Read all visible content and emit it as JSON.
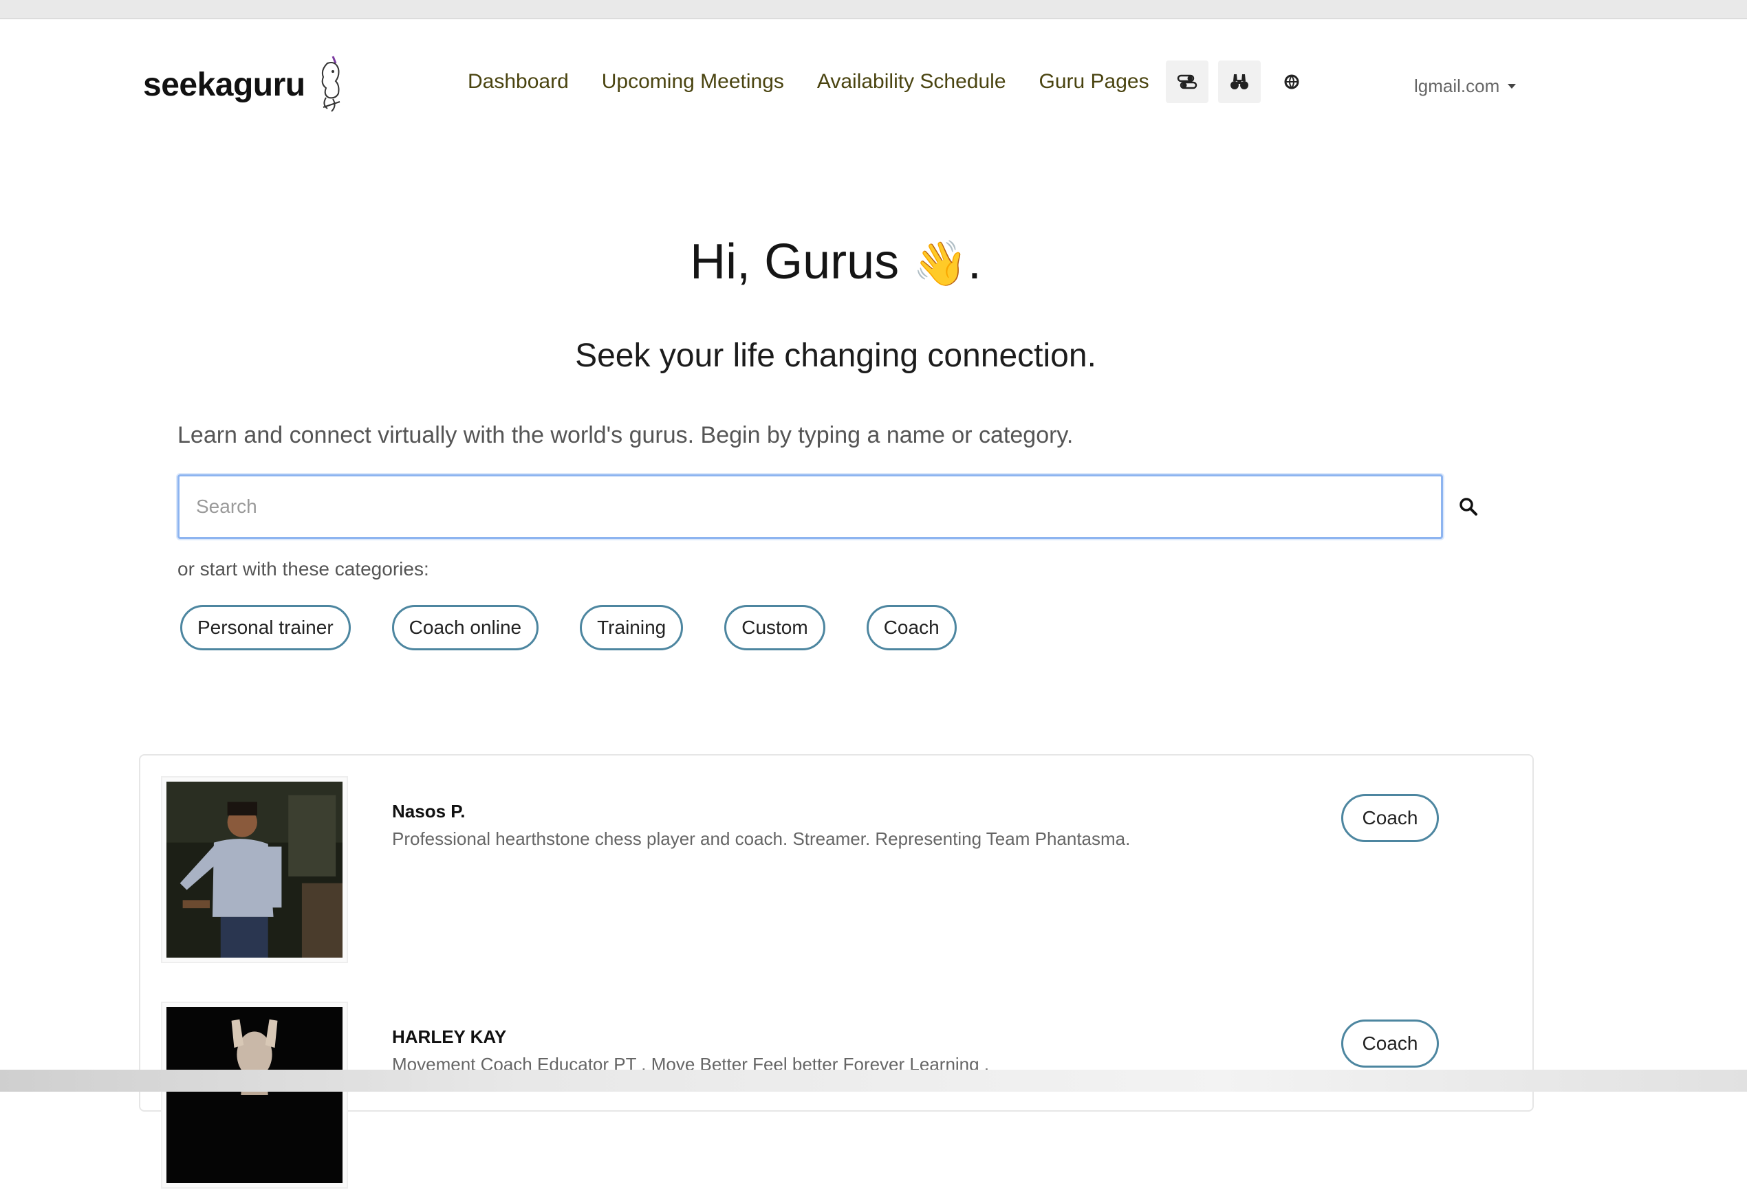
{
  "brand": {
    "name": "seekaguru"
  },
  "nav": {
    "links": [
      "Dashboard",
      "Upcoming Meetings",
      "Availability Schedule",
      "Guru Pages"
    ],
    "icons": [
      "toggle-settings-icon",
      "binoculars-icon",
      "globe-icon"
    ],
    "account": "lgmail.com"
  },
  "hero": {
    "greeting": "Hi, Gurus",
    "emoji": "👋",
    "period": ".",
    "subtitle": "Seek your life changing connection.",
    "intro": "Learn and connect virtually with the world's gurus. Begin by typing a name or category."
  },
  "search": {
    "placeholder": "Search",
    "value": ""
  },
  "categories": {
    "label": "or start with these categories:",
    "items": [
      "Personal trainer",
      "Coach online",
      "Training",
      "Custom",
      "Coach"
    ]
  },
  "results": [
    {
      "name": "Nasos P.",
      "description": "Professional hearthstone chess player and coach. Streamer. Representing Team Phantasma.",
      "tag": "Coach"
    },
    {
      "name": "HARLEY KAY",
      "description": "Movement Coach Educator PT . Move Better Feel better Forever Learning .",
      "tag": "Coach"
    }
  ]
}
